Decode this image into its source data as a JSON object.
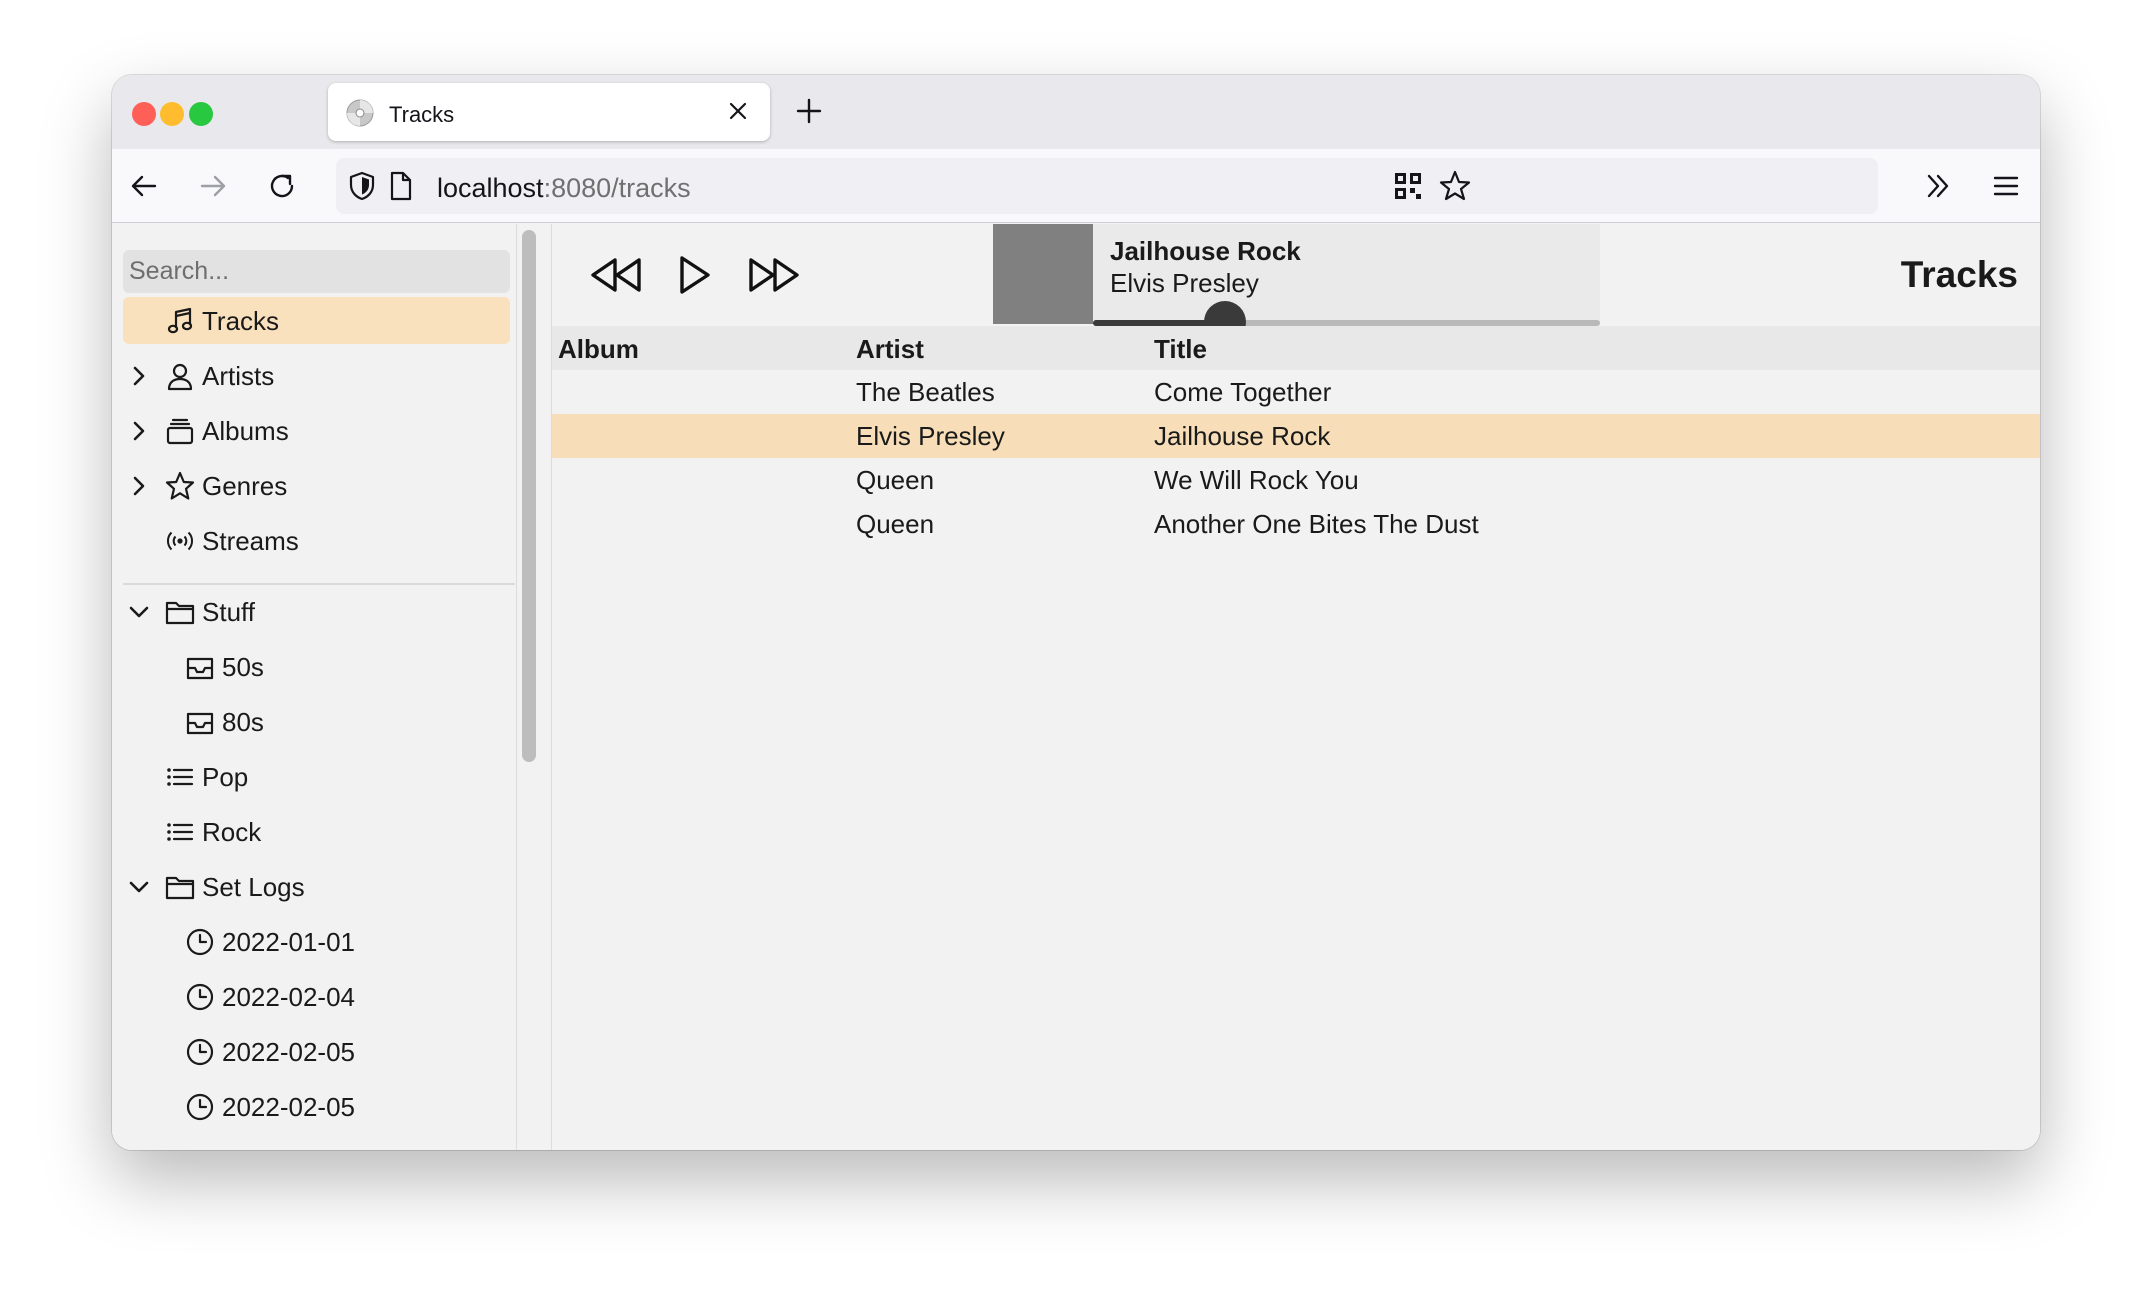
{
  "browser": {
    "tab_title": "Tracks",
    "url_host": "localhost",
    "url_rest": ":8080/tracks"
  },
  "sidebar": {
    "search_placeholder": "Search...",
    "items": [
      {
        "label": "Tracks",
        "icon": "music-note-icon",
        "active": true
      },
      {
        "label": "Artists",
        "icon": "person-icon",
        "expandable": true
      },
      {
        "label": "Albums",
        "icon": "album-stack-icon",
        "expandable": true
      },
      {
        "label": "Genres",
        "icon": "star-icon",
        "expandable": true
      },
      {
        "label": "Streams",
        "icon": "broadcast-icon"
      },
      {
        "label": "Stuff",
        "icon": "folder-icon",
        "expanded": true
      },
      {
        "label": "50s",
        "icon": "inbox-icon"
      },
      {
        "label": "80s",
        "icon": "inbox-icon"
      },
      {
        "label": "Pop",
        "icon": "list-icon"
      },
      {
        "label": "Rock",
        "icon": "list-icon"
      },
      {
        "label": "Set Logs",
        "icon": "folder-icon",
        "expanded": true
      },
      {
        "label": "2022-01-01",
        "icon": "clock-icon"
      },
      {
        "label": "2022-02-04",
        "icon": "clock-icon"
      },
      {
        "label": "2022-02-05",
        "icon": "clock-icon"
      },
      {
        "label": "2022-02-05",
        "icon": "clock-icon"
      }
    ]
  },
  "player": {
    "title": "Jailhouse Rock",
    "artist": "Elvis Presley",
    "progress": 0.26
  },
  "main": {
    "page_title": "Tracks",
    "columns": [
      "Album",
      "Artist",
      "Title"
    ],
    "rows": [
      {
        "album": "",
        "artist": "The Beatles",
        "title": "Come Together"
      },
      {
        "album": "",
        "artist": "Elvis Presley",
        "title": "Jailhouse Rock",
        "selected": true
      },
      {
        "album": "",
        "artist": "Queen",
        "title": "We Will Rock You"
      },
      {
        "album": "",
        "artist": "Queen",
        "title": "Another One Bites The Dust"
      }
    ]
  },
  "colors": {
    "active_item": "#fae1bd",
    "selected_row": "#f7deb8",
    "traffic_close": "#fe5f57",
    "traffic_min": "#febc2e",
    "traffic_max": "#28c840"
  }
}
